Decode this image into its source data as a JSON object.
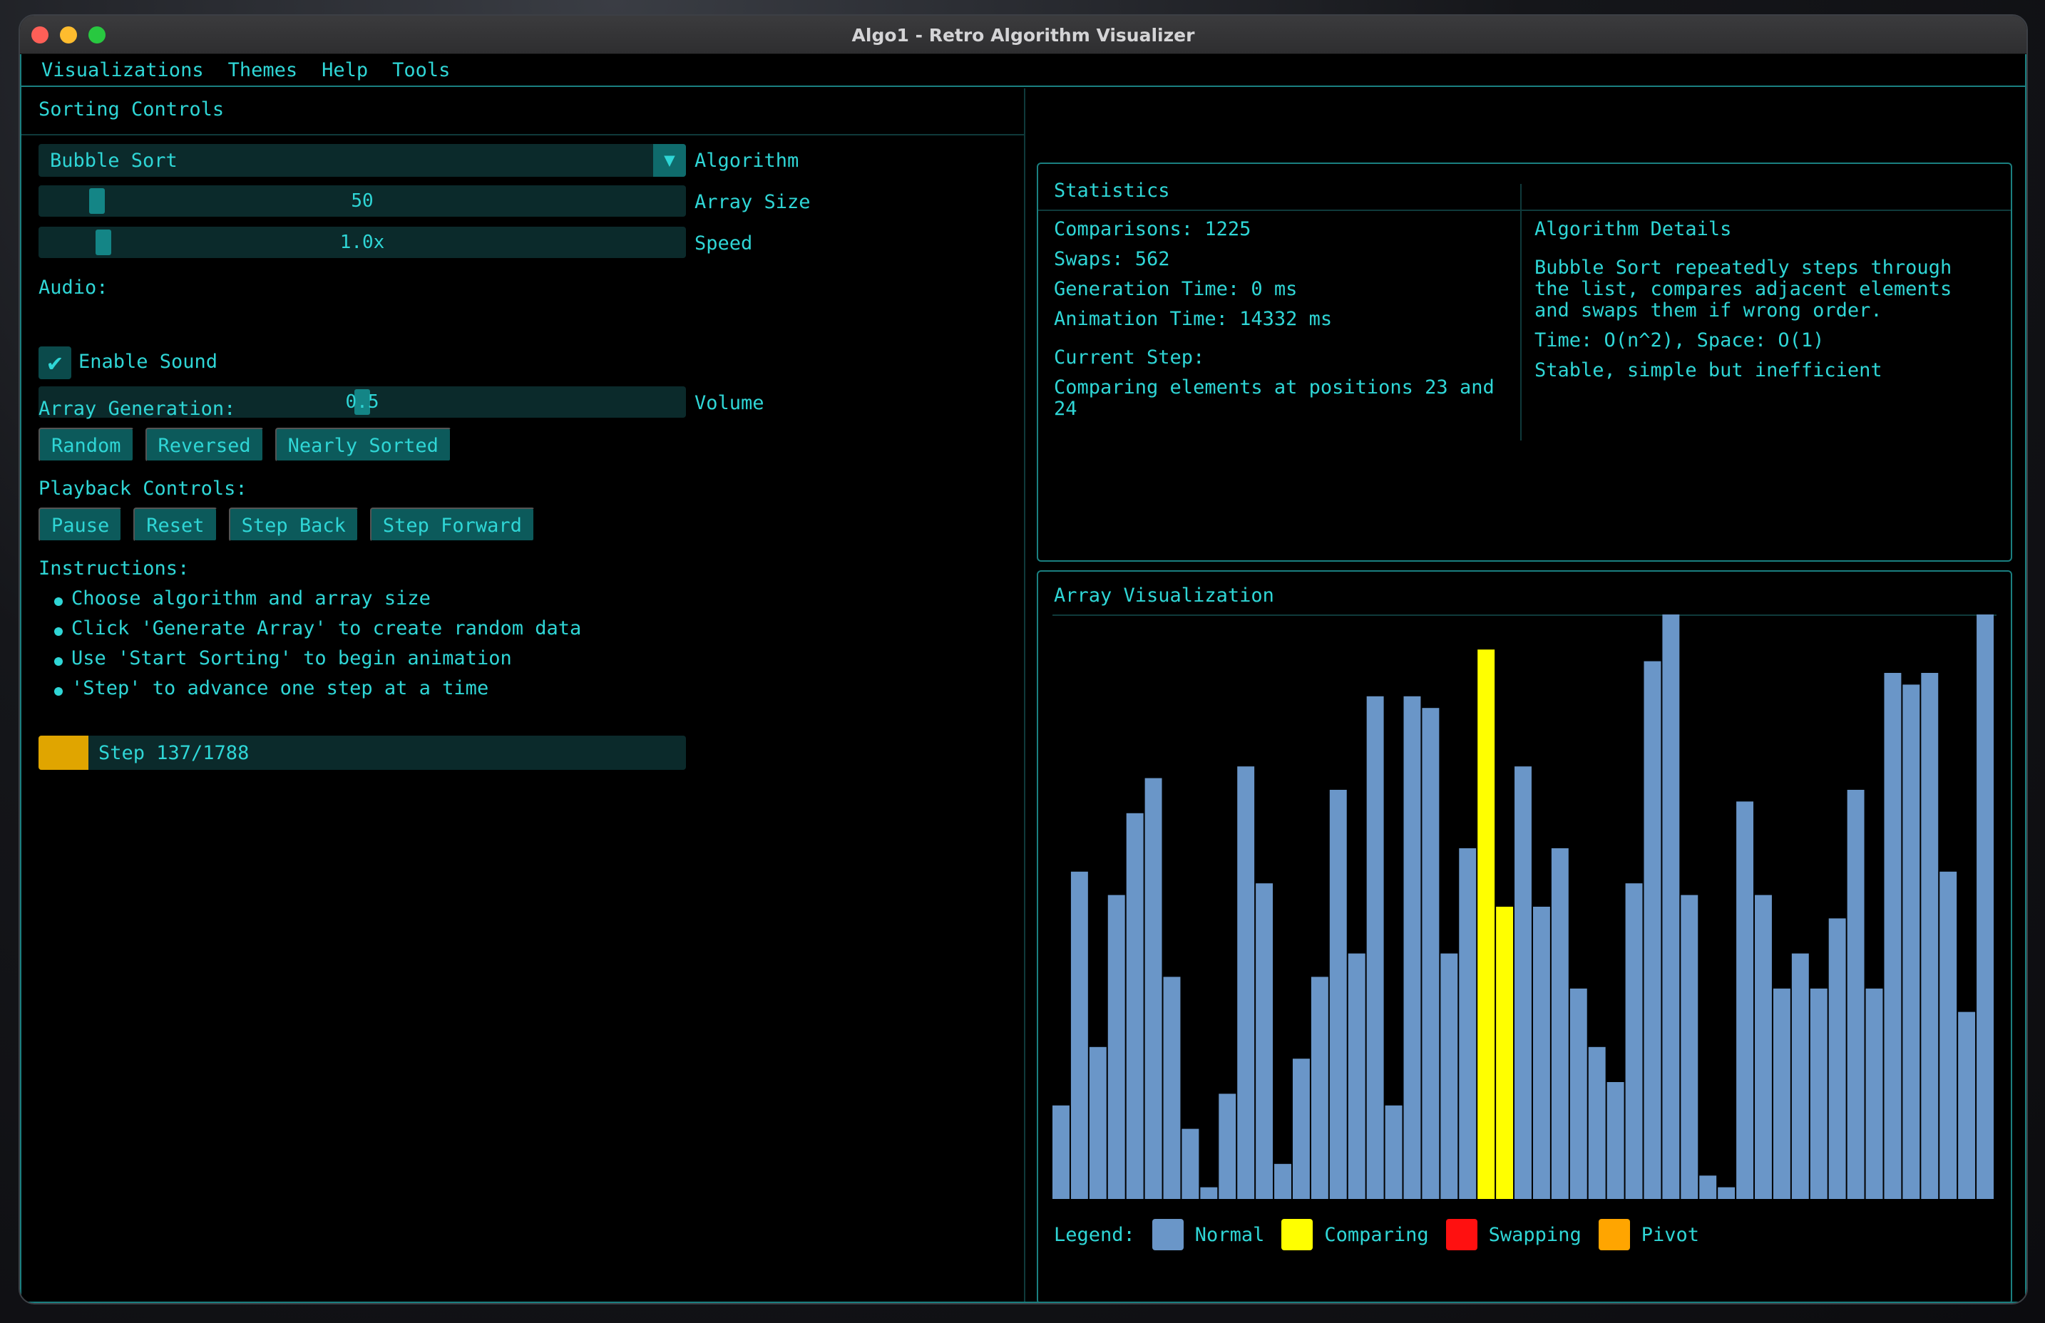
{
  "window": {
    "title": "Algo1 - Retro Algorithm Visualizer"
  },
  "menu": [
    "Visualizations",
    "Themes",
    "Help",
    "Tools"
  ],
  "controls": {
    "section_title": "Sorting Controls",
    "algorithm": {
      "selected": "Bubble Sort",
      "label": "Algorithm"
    },
    "array_size": {
      "value": "50",
      "label": "Array Size",
      "fraction": 0.08
    },
    "speed": {
      "value": "1.0x",
      "label": "Speed",
      "fraction": 0.09
    },
    "audio": {
      "heading": "Audio:",
      "enable_sound_label": "Enable Sound",
      "enabled": true,
      "volume": {
        "value": "0.5",
        "label": "Volume",
        "fraction": 0.5
      }
    },
    "array_generation": {
      "heading": "Array Generation:",
      "buttons": [
        "Random",
        "Reversed",
        "Nearly Sorted"
      ]
    },
    "playback": {
      "heading": "Playback Controls:",
      "buttons": [
        "Pause",
        "Reset",
        "Step Back",
        "Step Forward"
      ]
    },
    "instructions": {
      "heading": "Instructions:",
      "items": [
        "Choose algorithm and array size",
        "Click 'Generate Array' to create random data",
        "Use 'Start Sorting' to begin animation",
        "'Step' to advance one step at a time"
      ]
    },
    "progress": {
      "text": "Step 137/1788",
      "current": 137,
      "total": 1788
    }
  },
  "statistics": {
    "title": "Statistics",
    "comparisons": "Comparisons: 1225",
    "swaps": "Swaps: 562",
    "generation_time": "Generation Time: 0 ms",
    "animation_time": "Animation Time: 14332 ms",
    "current_step_heading": "Current Step:",
    "current_step_line1": "Comparing elements at positions 23 and",
    "current_step_line2": "24"
  },
  "algorithm_details": {
    "title": "Algorithm Details",
    "desc_line1": "Bubble Sort repeatedly steps through",
    "desc_line2": "the list, compares adjacent elements",
    "desc_line3": "and swaps them if wrong order.",
    "complexity": "Time: O(n^2), Space: O(1)",
    "note": "Stable, simple but inefficient"
  },
  "visualization": {
    "title": "Array Visualization",
    "legend_label": "Legend:",
    "legend": [
      {
        "name": "Normal",
        "color": "#6a96c8"
      },
      {
        "name": "Comparing",
        "color": "#ffff00"
      },
      {
        "name": "Swapping",
        "color": "#ff1010"
      },
      {
        "name": "Pivot",
        "color": "#ffa500"
      }
    ]
  },
  "chart_data": {
    "type": "bar",
    "comparing_indices": [
      23,
      24
    ],
    "values": [
      16,
      56,
      26,
      52,
      66,
      72,
      38,
      12,
      2,
      18,
      74,
      54,
      6,
      24,
      38,
      70,
      42,
      86,
      16,
      86,
      84,
      42,
      60,
      94,
      50,
      74,
      50,
      60,
      36,
      26,
      20,
      54,
      92,
      100,
      52,
      4,
      2,
      68,
      52,
      36,
      42,
      36,
      48,
      70,
      36,
      90,
      88,
      90,
      56,
      32,
      100
    ],
    "ylim": [
      0,
      100
    ]
  }
}
